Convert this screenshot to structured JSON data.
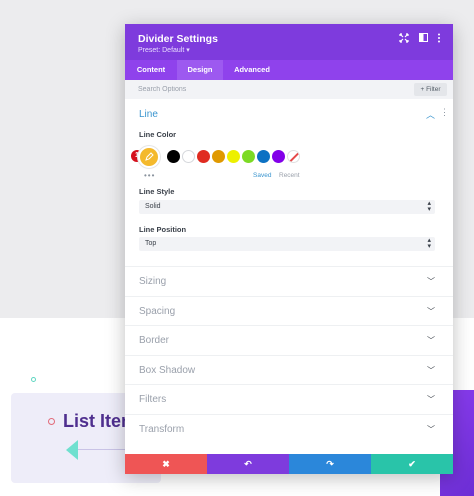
{
  "background": {
    "list_item_text": "List Item"
  },
  "modal": {
    "title": "Divider Settings",
    "preset": "Preset: Default ▾",
    "header_icons": [
      "expand-icon",
      "split-view-icon",
      "more-icon"
    ],
    "tabs": [
      {
        "label": "Content",
        "active": false
      },
      {
        "label": "Design",
        "active": true
      },
      {
        "label": "Advanced",
        "active": false
      }
    ],
    "search": {
      "placeholder": "Search Options",
      "filter_label": "+ Filter"
    },
    "line_section": {
      "title": "Line",
      "line_color_label": "Line Color",
      "badge": "1",
      "selected_color": "#f4b92c",
      "swatches": [
        "#000000",
        "#ffffff",
        "#e02b20",
        "#e09900",
        "#edf000",
        "#7cda24",
        "#0c71c3",
        "#8300e9",
        "none"
      ],
      "saved_label": "Saved",
      "recent_label": "Recent",
      "line_style_label": "Line Style",
      "line_style_value": "Solid",
      "line_position_label": "Line Position",
      "line_position_value": "Top"
    },
    "sections": [
      "Sizing",
      "Spacing",
      "Border",
      "Box Shadow",
      "Filters",
      "Transform"
    ],
    "footer": {
      "cancel": "✖",
      "undo": "↶",
      "redo": "↷",
      "save": "✔",
      "colors": [
        "#ef5555",
        "#7e3bdd",
        "#2b87da",
        "#29c4a9"
      ]
    },
    "colors": {
      "header": "#7e3bdd",
      "tabs": "#8f42ec",
      "accent": "#3a95cf"
    }
  }
}
